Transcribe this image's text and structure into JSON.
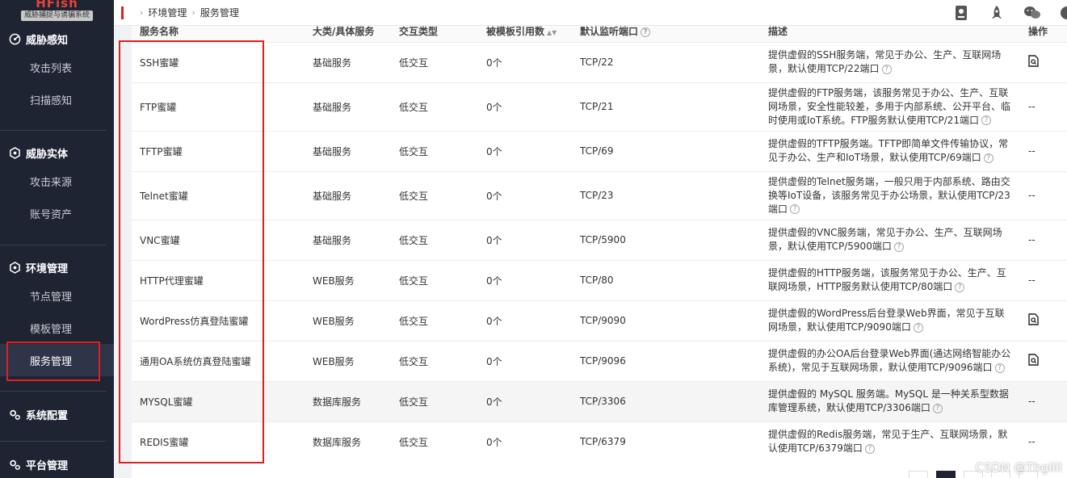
{
  "logo": {
    "title": "HFish",
    "subtitle": "威胁捕捉与诱骗系统"
  },
  "sidebar": {
    "groups": [
      {
        "label": "威胁感知",
        "icon": "radar-icon",
        "items": [
          "攻击列表",
          "扫描感知"
        ]
      },
      {
        "label": "威胁实体",
        "icon": "hexagon-icon",
        "items": [
          "攻击来源",
          "账号资产"
        ]
      },
      {
        "label": "环境管理",
        "icon": "hexagon-icon",
        "items": [
          "节点管理",
          "模板管理",
          "服务管理"
        ]
      },
      {
        "label": "系统配置",
        "icon": "gears-icon",
        "items": []
      },
      {
        "label": "平台管理",
        "icon": "gears-icon",
        "items": []
      }
    ],
    "active_item": "服务管理"
  },
  "breadcrumb": [
    "环境管理",
    "服务管理"
  ],
  "table": {
    "columns": [
      "服务名称",
      "大类/具体服务",
      "交互类型",
      "被模板引用数",
      "默认监听端口",
      "描述",
      "操作"
    ],
    "rows": [
      {
        "name": "SSH蜜罐",
        "category": "基础服务",
        "interaction": "低交互",
        "refs": "0个",
        "port": "TCP/22",
        "desc": "提供虚假的SSH服务端，常见于办公、生产、互联网场景，默认使用TCP/22端口",
        "op": "icon"
      },
      {
        "name": "FTP蜜罐",
        "category": "基础服务",
        "interaction": "低交互",
        "refs": "0个",
        "port": "TCP/21",
        "desc": "提供虚假的FTP服务端，该服务常见于办公、生产、互联网场景，安全性能较差，多用于内部系统、公开平台、临时使用或IoT系统。FTP服务默认使用TCP/21端口",
        "op": "--"
      },
      {
        "name": "TFTP蜜罐",
        "category": "基础服务",
        "interaction": "低交互",
        "refs": "0个",
        "port": "TCP/69",
        "desc": "提供虚假的TFTP服务端。TFTP即简单文件传输协议，常见于办公、生产和IoT场景，默认使用TCP/69端口",
        "op": "--"
      },
      {
        "name": "Telnet蜜罐",
        "category": "基础服务",
        "interaction": "低交互",
        "refs": "0个",
        "port": "TCP/23",
        "desc": "提供虚假的Telnet服务端，一般只用于内部系统、路由交换等IoT设备，该服务常见于办公场景，默认使用TCP/23端口",
        "op": "--"
      },
      {
        "name": "VNC蜜罐",
        "category": "基础服务",
        "interaction": "低交互",
        "refs": "0个",
        "port": "TCP/5900",
        "desc": "提供虚假的VNC服务端，常见于办公、生产、互联网场景，默认使用TCP/5900端口",
        "op": "--"
      },
      {
        "name": "HTTP代理蜜罐",
        "category": "WEB服务",
        "interaction": "低交互",
        "refs": "0个",
        "port": "TCP/80",
        "desc": "提供虚假的HTTP服务端，该服务常见于办公、生产、互联网场景，HTTP服务默认使用TCP/80端口",
        "op": "--"
      },
      {
        "name": "WordPress仿真登陆蜜罐",
        "category": "WEB服务",
        "interaction": "低交互",
        "refs": "0个",
        "port": "TCP/9090",
        "desc": "提供虚假的WordPress后台登录Web界面，常见于互联网场景，默认使用TCP/9090端口",
        "op": "icon"
      },
      {
        "name": "通用OA系统仿真登陆蜜罐",
        "category": "WEB服务",
        "interaction": "低交互",
        "refs": "0个",
        "port": "TCP/9096",
        "desc": "提供虚假的办公OA后台登录Web界面(通达网络智能办公系统)，常见于互联网场景，默认使用TCP/9096端口",
        "op": "icon"
      },
      {
        "name": "MYSQL蜜罐",
        "category": "数据库服务",
        "interaction": "低交互",
        "refs": "0个",
        "port": "TCP/3306",
        "desc": "提供虚假的 MySQL 服务端。MySQL 是一种关系型数据库管理系统，默认使用TCP/3306端口",
        "op": "--"
      },
      {
        "name": "REDIS蜜罐",
        "category": "数据库服务",
        "interaction": "低交互",
        "refs": "0个",
        "port": "TCP/6379",
        "desc": "提供虚假的Redis服务端，常见于生产、互联网场景，默认使用TCP/6379端口",
        "op": "--"
      }
    ]
  },
  "watermark": "CSDN @Thgilil",
  "colors": {
    "sidebar_bg": "#1f2433",
    "highlight_red": "#e02020",
    "brand_red": "#e8433a"
  }
}
